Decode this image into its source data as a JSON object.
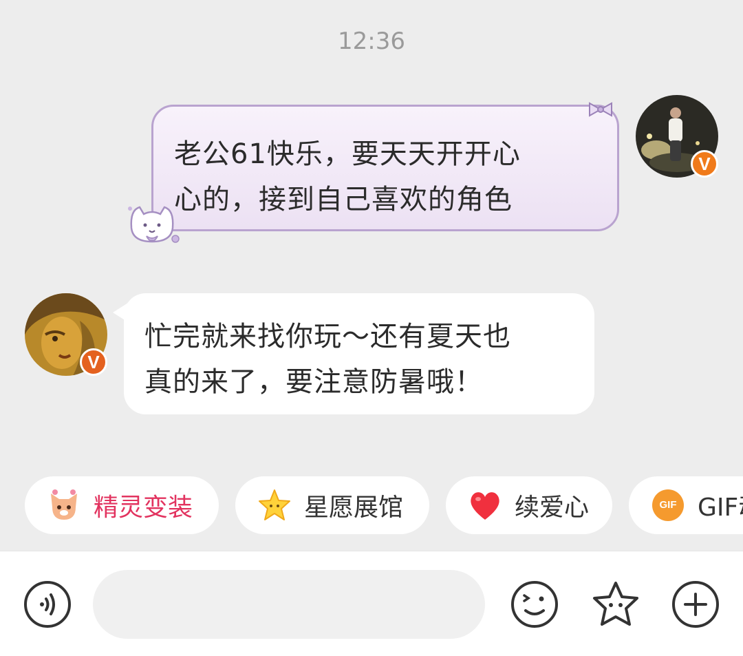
{
  "timestamp": "12:36",
  "messages": [
    {
      "direction": "outgoing",
      "line1": "老公61快乐，要天天开开心",
      "line2": "心的，接到自己喜欢的角色"
    },
    {
      "direction": "incoming",
      "line1": "忙完就来找你玩～还有夏天也",
      "line2": "真的来了，要注意防暑哦！"
    }
  ],
  "verified_badge": "V",
  "quick_actions": [
    {
      "label": "精灵变装",
      "icon": "fox-sprite-icon",
      "color": "#e2335f"
    },
    {
      "label": "星愿展馆",
      "icon": "star-icon"
    },
    {
      "label": "续爱心",
      "icon": "heart-icon"
    },
    {
      "label": "GIF动",
      "icon": "gif-icon",
      "icon_text": "GIF"
    }
  ],
  "input_bar": {
    "placeholder": "",
    "icons": [
      "voice-icon",
      "emoji-icon",
      "sticker-icon",
      "plus-icon"
    ]
  },
  "colors": {
    "background": "#ededed",
    "accent_pink": "#e2335f",
    "verified_orange": "#f07a1a"
  }
}
